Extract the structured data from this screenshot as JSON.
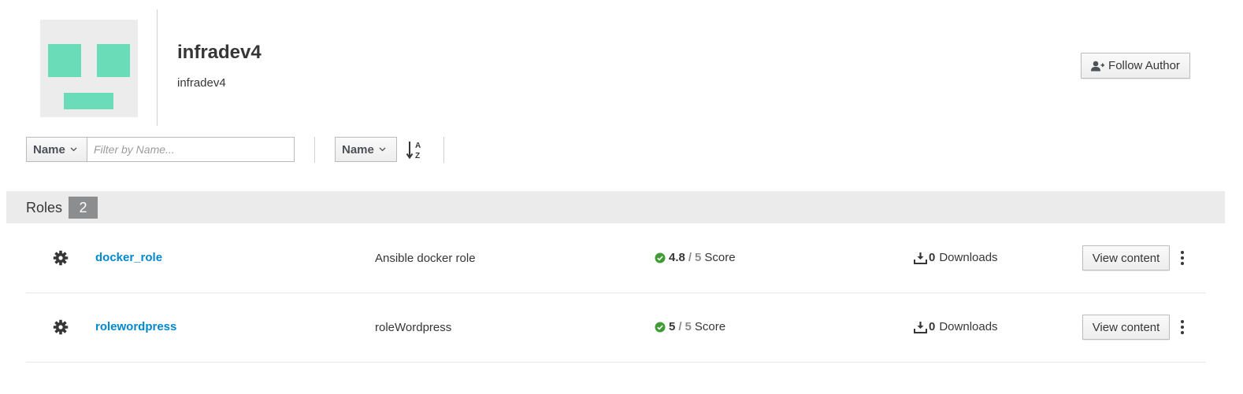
{
  "author": {
    "title": "infradev4",
    "subtitle": "infradev4",
    "follow_label": "Follow Author"
  },
  "toolbar": {
    "filter_field": "Name",
    "filter_placeholder": "Filter by Name...",
    "sort_field": "Name"
  },
  "roles": {
    "label": "Roles",
    "count": "2",
    "items": [
      {
        "name": "docker_role",
        "description": "Ansible docker role",
        "score": "4.8",
        "score_max": "5",
        "score_label": "Score",
        "downloads": "0",
        "downloads_label": "Downloads",
        "view_label": "View content"
      },
      {
        "name": "rolewordpress",
        "description": "roleWordpress",
        "score": "5",
        "score_max": "5",
        "score_label": "Score",
        "downloads": "0",
        "downloads_label": "Downloads",
        "view_label": "View content"
      }
    ]
  },
  "colors": {
    "link": "#0088ce",
    "avatar_bg": "#ececec",
    "avatar_fg": "#6adcb8",
    "score_ok": "#3f9c35",
    "badge": "#8b8d8f"
  },
  "icons": {
    "follow": "user-plus-icon",
    "sort": "sort-alpha-asc-icon",
    "role": "gear-icon",
    "score": "check-circle-icon",
    "downloads": "download-icon",
    "menu": "kebab-icon"
  }
}
